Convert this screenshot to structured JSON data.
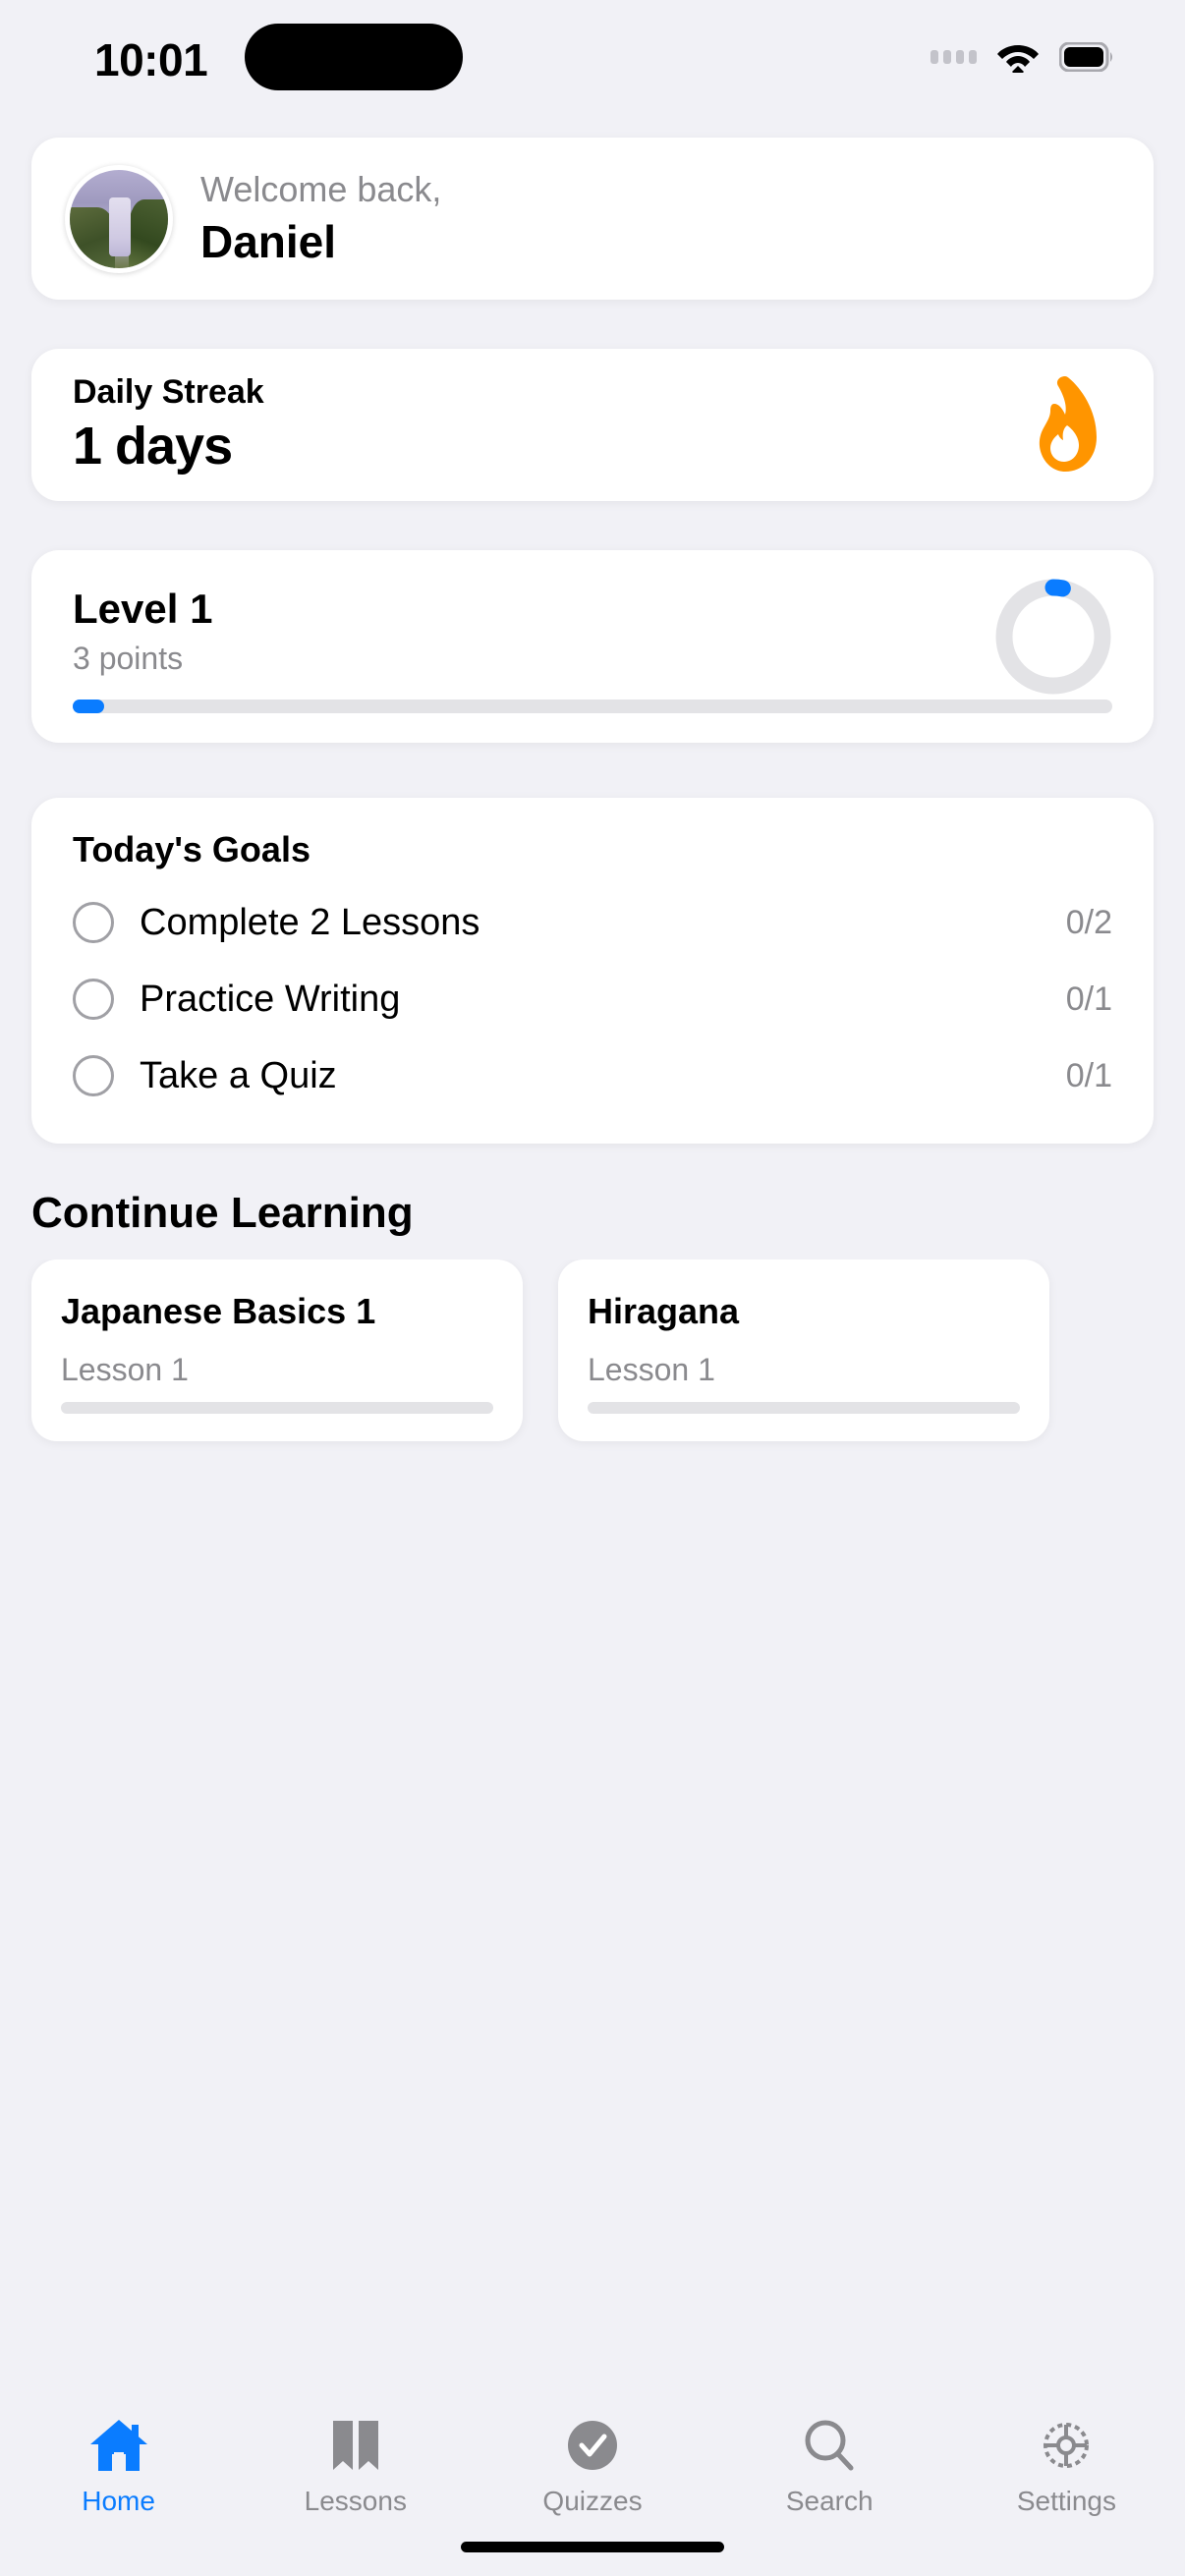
{
  "status_bar": {
    "time": "10:01",
    "cellular_icon": "cellular-dots-icon",
    "wifi_icon": "wifi-icon",
    "battery_icon": "battery-icon"
  },
  "welcome": {
    "greeting": "Welcome back,",
    "name": "Daniel",
    "avatar_icon": "avatar-waterfall-photo"
  },
  "streak": {
    "label": "Daily Streak",
    "value": "1 days",
    "icon": "flame-icon",
    "icon_color": "#FF9500"
  },
  "level": {
    "title": "Level 1",
    "points": "3 points",
    "ring_progress_percent": 3,
    "bar_progress_percent": 3,
    "accent_color": "#0A7CFF",
    "track_color": "#E3E3E6"
  },
  "goals": {
    "title": "Today's Goals",
    "items": [
      {
        "label": "Complete 2 Lessons",
        "count": "0/2",
        "checked": false
      },
      {
        "label": "Practice Writing",
        "count": "0/1",
        "checked": false
      },
      {
        "label": "Take a Quiz",
        "count": "0/1",
        "checked": false
      }
    ]
  },
  "continue_learning": {
    "heading": "Continue Learning",
    "courses": [
      {
        "title": "Japanese Basics 1",
        "subtitle": "Lesson 1",
        "progress_percent": 0
      },
      {
        "title": "Hiragana",
        "subtitle": "Lesson 1",
        "progress_percent": 0
      }
    ]
  },
  "tabbar": {
    "items": [
      {
        "label": "Home",
        "icon": "home-icon",
        "active": true
      },
      {
        "label": "Lessons",
        "icon": "book-icon",
        "active": false
      },
      {
        "label": "Quizzes",
        "icon": "check-circle-icon",
        "active": false
      },
      {
        "label": "Search",
        "icon": "search-icon",
        "active": false
      },
      {
        "label": "Settings",
        "icon": "gear-icon",
        "active": false
      }
    ],
    "active_color": "#0A7CFF",
    "inactive_color": "#8A8A8E"
  }
}
